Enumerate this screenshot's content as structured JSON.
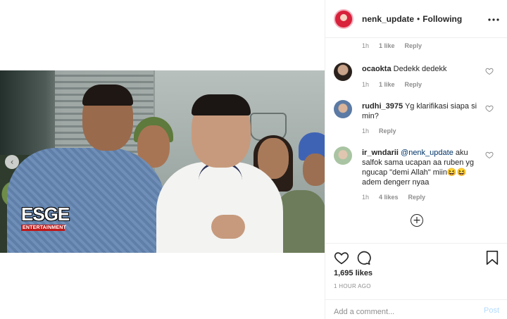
{
  "header": {
    "username": "nenk_update",
    "separator": "•",
    "follow_state": "Following",
    "more_icon": "ellipsis-icon"
  },
  "media": {
    "watermark_main": "ESGE",
    "watermark_sub": "ENTERTAINMENT",
    "prev_icon": "‹"
  },
  "comments": {
    "top_meta": {
      "time": "1h",
      "likes": "1 like",
      "reply": "Reply"
    },
    "items": [
      {
        "username": "ocaokta",
        "text": "Dedekk dedekk",
        "time": "1h",
        "likes": "1 like",
        "reply": "Reply"
      },
      {
        "username": "rudhi_3975",
        "text": "Yg klarifikasi siapa si min?",
        "time": "1h",
        "likes": "",
        "reply": "Reply"
      },
      {
        "username": "ir_wndarii",
        "mention": "@nenk_update",
        "text": "aku salfok sama ucapan aa ruben yg ngucap \"demi Allah\" miin😆😆 adem dengerr nyaa",
        "time": "1h",
        "likes": "4 likes",
        "reply": "Reply"
      }
    ],
    "load_more_icon": "+"
  },
  "actions": {
    "likes": "1,695 likes",
    "posted": "1 HOUR AGO"
  },
  "add_comment": {
    "placeholder": "Add a comment...",
    "post_label": "Post"
  },
  "colors": {
    "text": "#262626",
    "muted": "#8e8e8e",
    "mention": "#003569",
    "post_disabled": "#b3dbff",
    "divider": "#efefef"
  }
}
